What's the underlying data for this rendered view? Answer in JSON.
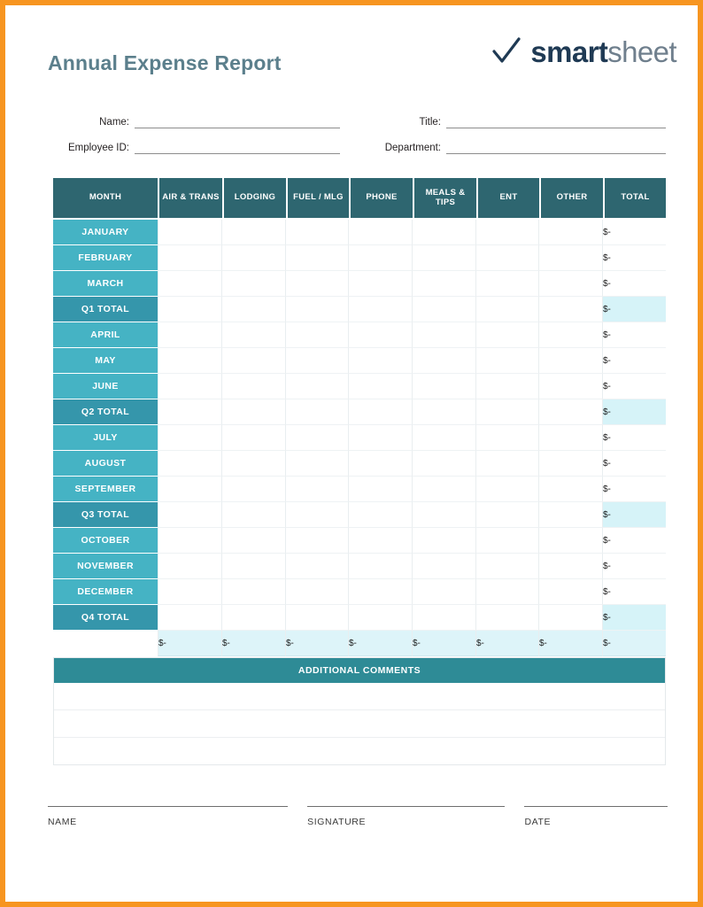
{
  "document": {
    "title": "Annual Expense Report",
    "brand": {
      "check_icon": "check-icon",
      "name_bold": "smart",
      "name_light": "sheet"
    },
    "accent_border_color": "#f79520",
    "title_color": "#5b7f8c",
    "header_color": "#2e6670",
    "month_row_color": "#45b3c4",
    "quarter_row_color": "#3596ab",
    "total_highlight_color": "#d6f3f8"
  },
  "form": {
    "name": {
      "label": "Name:",
      "value": ""
    },
    "title": {
      "label": "Title:",
      "value": ""
    },
    "employee_id": {
      "label": "Employee ID:",
      "value": ""
    },
    "department": {
      "label": "Department:",
      "value": ""
    }
  },
  "table": {
    "columns": [
      "MONTH",
      "AIR & TRANS",
      "LODGING",
      "FUEL / MLG",
      "PHONE",
      "MEALS & TIPS",
      "ENT",
      "OTHER",
      "TOTAL"
    ],
    "rows": [
      {
        "label": "JANUARY",
        "type": "month",
        "cells": [
          "",
          "",
          "",
          "",
          "",
          "",
          ""
        ],
        "total": "$-"
      },
      {
        "label": "FEBRUARY",
        "type": "month",
        "cells": [
          "",
          "",
          "",
          "",
          "",
          "",
          ""
        ],
        "total": "$-"
      },
      {
        "label": "MARCH",
        "type": "month",
        "cells": [
          "",
          "",
          "",
          "",
          "",
          "",
          ""
        ],
        "total": "$-"
      },
      {
        "label": "Q1 TOTAL",
        "type": "quarter",
        "cells": [
          "",
          "",
          "",
          "",
          "",
          "",
          ""
        ],
        "total": "$-"
      },
      {
        "label": "APRIL",
        "type": "month",
        "cells": [
          "",
          "",
          "",
          "",
          "",
          "",
          ""
        ],
        "total": "$-"
      },
      {
        "label": "MAY",
        "type": "month",
        "cells": [
          "",
          "",
          "",
          "",
          "",
          "",
          ""
        ],
        "total": "$-"
      },
      {
        "label": "JUNE",
        "type": "month",
        "cells": [
          "",
          "",
          "",
          "",
          "",
          "",
          ""
        ],
        "total": "$-"
      },
      {
        "label": "Q2 TOTAL",
        "type": "quarter",
        "cells": [
          "",
          "",
          "",
          "",
          "",
          "",
          ""
        ],
        "total": "$-"
      },
      {
        "label": "JULY",
        "type": "month",
        "cells": [
          "",
          "",
          "",
          "",
          "",
          "",
          ""
        ],
        "total": "$-"
      },
      {
        "label": "AUGUST",
        "type": "month",
        "cells": [
          "",
          "",
          "",
          "",
          "",
          "",
          ""
        ],
        "total": "$-"
      },
      {
        "label": "SEPTEMBER",
        "type": "month",
        "cells": [
          "",
          "",
          "",
          "",
          "",
          "",
          ""
        ],
        "total": "$-"
      },
      {
        "label": "Q3 TOTAL",
        "type": "quarter",
        "cells": [
          "",
          "",
          "",
          "",
          "",
          "",
          ""
        ],
        "total": "$-"
      },
      {
        "label": "OCTOBER",
        "type": "month",
        "cells": [
          "",
          "",
          "",
          "",
          "",
          "",
          ""
        ],
        "total": "$-"
      },
      {
        "label": "NOVEMBER",
        "type": "month",
        "cells": [
          "",
          "",
          "",
          "",
          "",
          "",
          ""
        ],
        "total": "$-"
      },
      {
        "label": "DECEMBER",
        "type": "month",
        "cells": [
          "",
          "",
          "",
          "",
          "",
          "",
          ""
        ],
        "total": "$-"
      },
      {
        "label": "Q4 TOTAL",
        "type": "quarter",
        "cells": [
          "",
          "",
          "",
          "",
          "",
          "",
          ""
        ],
        "total": "$-"
      },
      {
        "label": "",
        "type": "grand",
        "cells": [
          "$-",
          "$-",
          "$-",
          "$-",
          "$-",
          "$-",
          "$-"
        ],
        "total": "$-"
      }
    ]
  },
  "comments": {
    "header": "ADDITIONAL COMMENTS",
    "lines": [
      "",
      "",
      ""
    ]
  },
  "signature": {
    "name_label": "NAME",
    "signature_label": "SIGNATURE",
    "date_label": "DATE",
    "name_value": "",
    "signature_value": "",
    "date_value": ""
  }
}
